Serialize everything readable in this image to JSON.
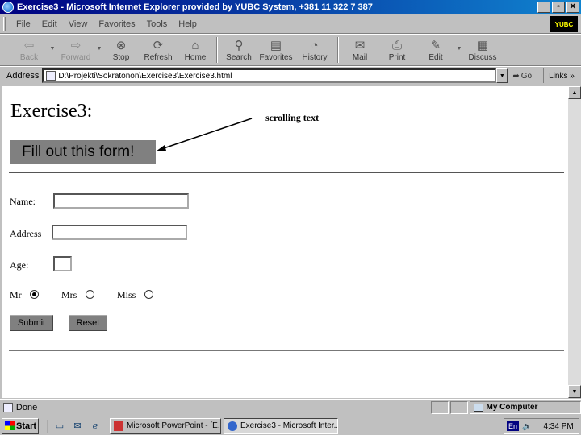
{
  "window": {
    "title": "Exercise3 - Microsoft Internet Explorer provided by YUBC System, +381 11 322 7 387",
    "buttons": [
      "_",
      "▫",
      "✕"
    ]
  },
  "menu": [
    "File",
    "Edit",
    "View",
    "Favorites",
    "Tools",
    "Help"
  ],
  "brand_logo": "YUBC",
  "toolbar": [
    {
      "label": "Back",
      "icon": "back-arrow-icon",
      "glyph": "⇦",
      "disabled": true
    },
    {
      "label": "Forward",
      "icon": "forward-arrow-icon",
      "glyph": "⇨",
      "disabled": true
    },
    {
      "label": "Stop",
      "icon": "stop-icon",
      "glyph": "⊗"
    },
    {
      "label": "Refresh",
      "icon": "refresh-icon",
      "glyph": "⟳"
    },
    {
      "label": "Home",
      "icon": "home-icon",
      "glyph": "⌂"
    },
    {
      "label": "Search",
      "icon": "search-icon",
      "glyph": "⚲"
    },
    {
      "label": "Favorites",
      "icon": "favorites-icon",
      "glyph": "▤"
    },
    {
      "label": "History",
      "icon": "history-icon",
      "glyph": "◔"
    },
    {
      "label": "Mail",
      "icon": "mail-icon",
      "glyph": "✉"
    },
    {
      "label": "Print",
      "icon": "print-icon",
      "glyph": "⎙"
    },
    {
      "label": "Edit",
      "icon": "edit-icon",
      "glyph": "✎"
    },
    {
      "label": "Discuss",
      "icon": "discuss-icon",
      "glyph": "▦"
    }
  ],
  "address": {
    "label": "Address",
    "value": "D:\\Projekti\\Sokratonon\\Exercise3\\Exercise3.html",
    "go": "Go",
    "links": "Links"
  },
  "page": {
    "heading": "Exercise3:",
    "annotation": "scrolling text",
    "marquee": "Fill out this form!",
    "form": {
      "name_label": "Name:",
      "address_label": "Address",
      "age_label": "Age:",
      "radios": [
        {
          "label": "Mr",
          "checked": true
        },
        {
          "label": "Mrs",
          "checked": false
        },
        {
          "label": "Miss",
          "checked": false
        }
      ],
      "submit": "Submit",
      "reset": "Reset"
    }
  },
  "status": {
    "text": "Done",
    "zone": "My Computer"
  },
  "taskbar": {
    "start": "Start",
    "tasks": [
      {
        "label": "Microsoft PowerPoint - [E...",
        "active": false
      },
      {
        "label": "Exercise3 - Microsoft Inter...",
        "active": true
      }
    ],
    "lang": "En",
    "clock": "4:34 PM"
  }
}
